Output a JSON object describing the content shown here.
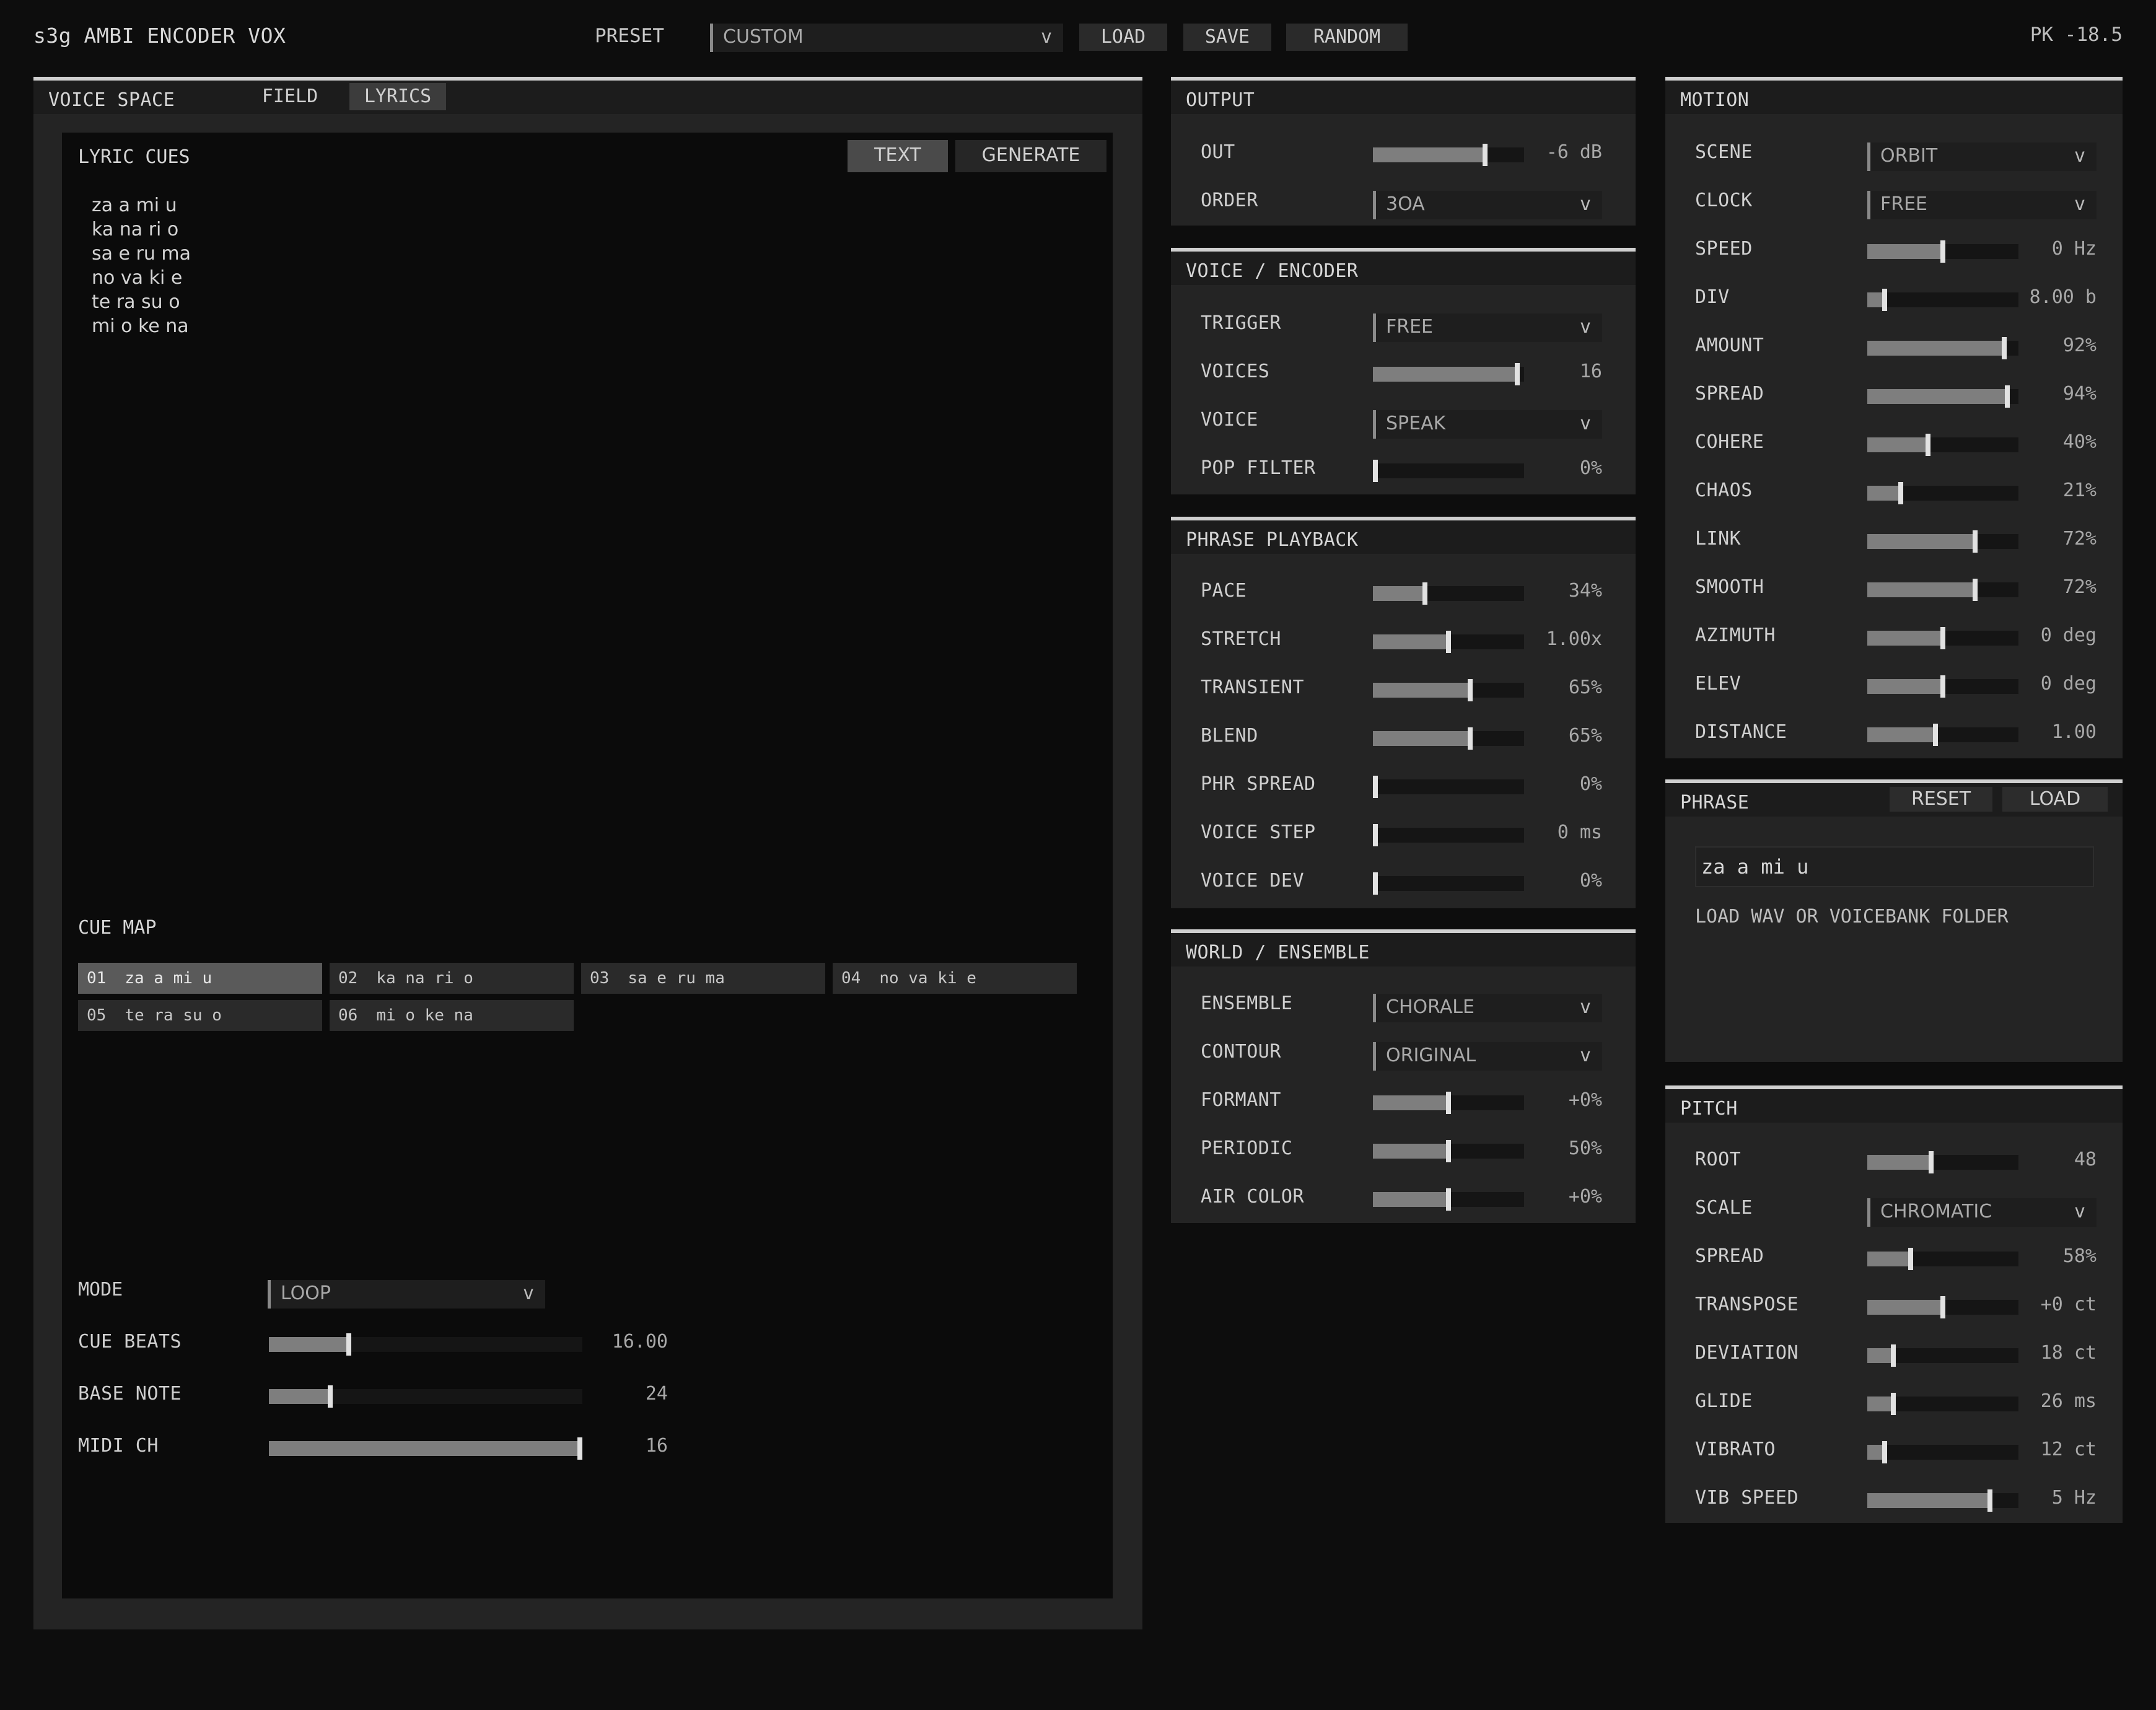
{
  "header": {
    "title": "s3g AMBI ENCODER VOX",
    "preset_label": "PRESET",
    "preset_value": "CUSTOM",
    "load": "LOAD",
    "save": "SAVE",
    "random": "RANDOM",
    "peak": "PK -18.5"
  },
  "chevron": "v",
  "voice_space": {
    "title": "VOICE SPACE",
    "tabs": [
      "FIELD",
      "LYRICS"
    ],
    "active_tab": "LYRICS",
    "lyric_cues_label": "LYRIC CUES",
    "text_btn": "TEXT",
    "generate_btn": "GENERATE",
    "lyrics": [
      "za a mi u",
      "ka na ri o",
      "sa e ru ma",
      "no va ki e",
      "te ra su o",
      "mi o ke na"
    ],
    "cue_map_label": "CUE MAP",
    "cues": [
      {
        "num": "01",
        "text": "za a mi u",
        "active": true
      },
      {
        "num": "02",
        "text": "ka na ri o",
        "active": false
      },
      {
        "num": "03",
        "text": "sa e ru ma",
        "active": false
      },
      {
        "num": "04",
        "text": "no va ki e",
        "active": false
      },
      {
        "num": "05",
        "text": "te ra su o",
        "active": false
      },
      {
        "num": "06",
        "text": "mi o ke na",
        "active": false
      }
    ],
    "mode": {
      "label": "MODE",
      "value": "LOOP"
    },
    "sliders": [
      {
        "label": "CUE BEATS",
        "value": "16.00",
        "level": 0.25
      },
      {
        "label": "BASE NOTE",
        "value": "24",
        "level": 0.19
      },
      {
        "label": "MIDI CH",
        "value": "16",
        "level": 1.0
      }
    ]
  },
  "output": {
    "title": "OUTPUT",
    "out": {
      "label": "OUT",
      "value": "-6 dB",
      "level": 0.75
    },
    "order": {
      "label": "ORDER",
      "value": "3OA"
    }
  },
  "voice_encoder": {
    "title": "VOICE / ENCODER",
    "trigger": {
      "label": "TRIGGER",
      "value": "FREE"
    },
    "voices": {
      "label": "VOICES",
      "value": "16",
      "level": 0.97
    },
    "voice": {
      "label": "VOICE",
      "value": "SPEAK"
    },
    "pop_filter": {
      "label": "POP FILTER",
      "value": "0%",
      "level": 0.0
    }
  },
  "phrase_playback": {
    "title": "PHRASE PLAYBACK",
    "rows": [
      {
        "label": "PACE",
        "value": "34%",
        "level": 0.34
      },
      {
        "label": "STRETCH",
        "value": "1.00x",
        "level": 0.5
      },
      {
        "label": "TRANSIENT",
        "value": "65%",
        "level": 0.65
      },
      {
        "label": "BLEND",
        "value": "65%",
        "level": 0.65
      },
      {
        "label": "PHR SPREAD",
        "value": "0%",
        "level": 0.0
      },
      {
        "label": "VOICE STEP",
        "value": "0 ms",
        "level": 0.0
      },
      {
        "label": "VOICE DEV",
        "value": "0%",
        "level": 0.0
      }
    ]
  },
  "world_ensemble": {
    "title": "WORLD / ENSEMBLE",
    "ensemble": {
      "label": "ENSEMBLE",
      "value": "CHORALE"
    },
    "contour": {
      "label": "CONTOUR",
      "value": "ORIGINAL"
    },
    "rows": [
      {
        "label": "FORMANT",
        "value": "+0%",
        "level": 0.5
      },
      {
        "label": "PERIODIC",
        "value": "50%",
        "level": 0.5
      },
      {
        "label": "AIR COLOR",
        "value": "+0%",
        "level": 0.5
      }
    ]
  },
  "motion": {
    "title": "MOTION",
    "scene": {
      "label": "SCENE",
      "value": "ORBIT"
    },
    "clock": {
      "label": "CLOCK",
      "value": "FREE"
    },
    "rows": [
      {
        "label": "SPEED",
        "value": "0 Hz",
        "level": 0.5
      },
      {
        "label": "DIV",
        "value": "8.00 b",
        "level": 0.1
      },
      {
        "label": "AMOUNT",
        "value": "92%",
        "level": 0.92
      },
      {
        "label": "SPREAD",
        "value": "94%",
        "level": 0.94
      },
      {
        "label": "COHERE",
        "value": "40%",
        "level": 0.4
      },
      {
        "label": "CHAOS",
        "value": "21%",
        "level": 0.21
      },
      {
        "label": "LINK",
        "value": "72%",
        "level": 0.72
      },
      {
        "label": "SMOOTH",
        "value": "72%",
        "level": 0.72
      },
      {
        "label": "AZIMUTH",
        "value": "0 deg",
        "level": 0.5
      },
      {
        "label": "ELEV",
        "value": "0 deg",
        "level": 0.5
      },
      {
        "label": "DISTANCE",
        "value": "1.00",
        "level": 0.45
      }
    ]
  },
  "phrase": {
    "title": "PHRASE",
    "reset": "RESET",
    "load": "LOAD",
    "text": "za a mi u",
    "hint": "LOAD WAV OR VOICEBANK FOLDER"
  },
  "pitch": {
    "title": "PITCH",
    "root": {
      "label": "ROOT",
      "value": "48",
      "level": 0.42
    },
    "scale": {
      "label": "SCALE",
      "value": "CHROMATIC"
    },
    "rows": [
      {
        "label": "SPREAD",
        "value": "58%",
        "level": 0.28
      },
      {
        "label": "TRANSPOSE",
        "value": "+0 ct",
        "level": 0.5
      },
      {
        "label": "DEVIATION",
        "value": "18 ct",
        "level": 0.16
      },
      {
        "label": "GLIDE",
        "value": "26 ms",
        "level": 0.16
      },
      {
        "label": "VIBRATO",
        "value": "12 ct",
        "level": 0.1
      },
      {
        "label": "VIB SPEED",
        "value": "5 Hz",
        "level": 0.82
      }
    ]
  }
}
